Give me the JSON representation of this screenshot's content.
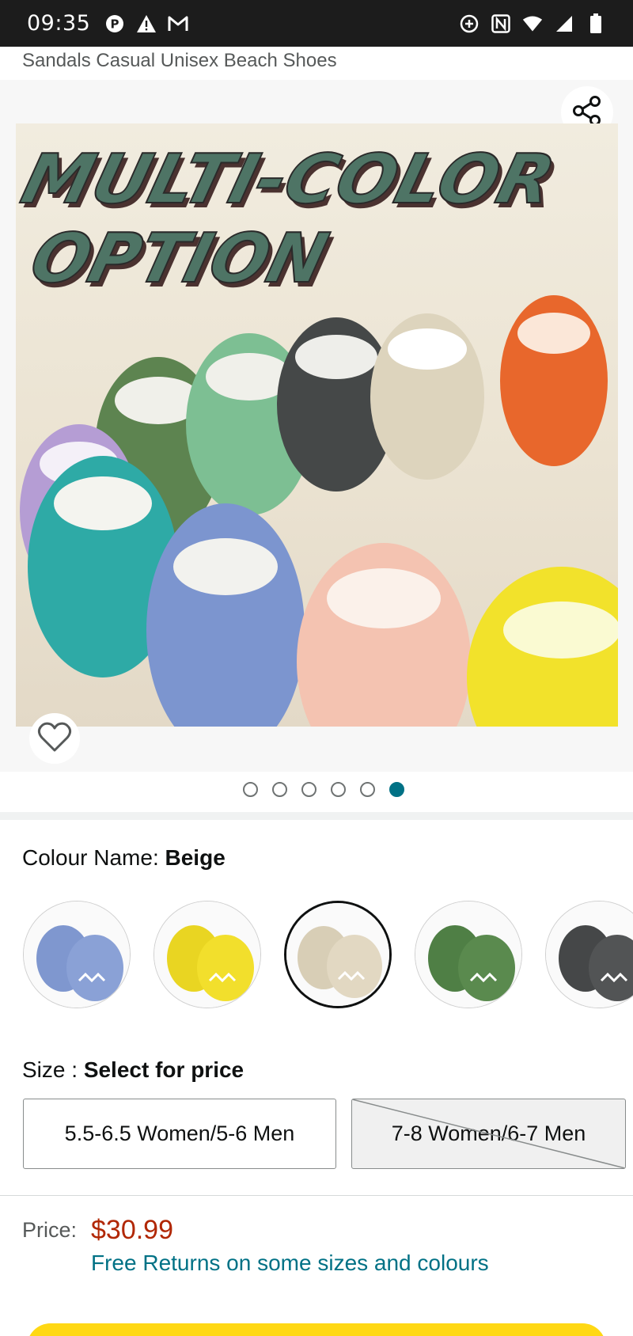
{
  "status_bar": {
    "time": "09:35",
    "left_icons": [
      "pinterest-icon",
      "warning-icon",
      "gmail-icon"
    ],
    "right_icons": [
      "data-saver-icon",
      "nfc-icon",
      "wifi-icon",
      "signal-icon",
      "battery-icon"
    ]
  },
  "product": {
    "title": "Sandals Casual Unisex Beach Shoes",
    "image_banner": [
      "MULTI-COLOR",
      "OPTION"
    ]
  },
  "gallery": {
    "dot_count": 6,
    "active_index": 5
  },
  "colour": {
    "label": "Colour Name:",
    "selected": "Beige",
    "swatches": [
      {
        "name": "Blue",
        "color": "#7f97cf"
      },
      {
        "name": "Yellow",
        "color": "#f0dc2e"
      },
      {
        "name": "Beige",
        "color": "#ddd3bd"
      },
      {
        "name": "Green",
        "color": "#5a8a4e"
      },
      {
        "name": "Grey",
        "color": "#4f5152"
      }
    ]
  },
  "size": {
    "label": "Size :",
    "prompt": "Select for price",
    "options": [
      {
        "label": "5.5-6.5 Women/5-6 Men",
        "available": true
      },
      {
        "label": "7-8 Women/6-7 Men",
        "available": false
      }
    ]
  },
  "price": {
    "label": "Price:",
    "value": "$30.99",
    "returns_text": "Free Returns on some sizes and colours"
  },
  "colors": {
    "price": "#b12704",
    "link": "#007185",
    "active_dot": "#007185",
    "buy_button": "#ffd814"
  }
}
